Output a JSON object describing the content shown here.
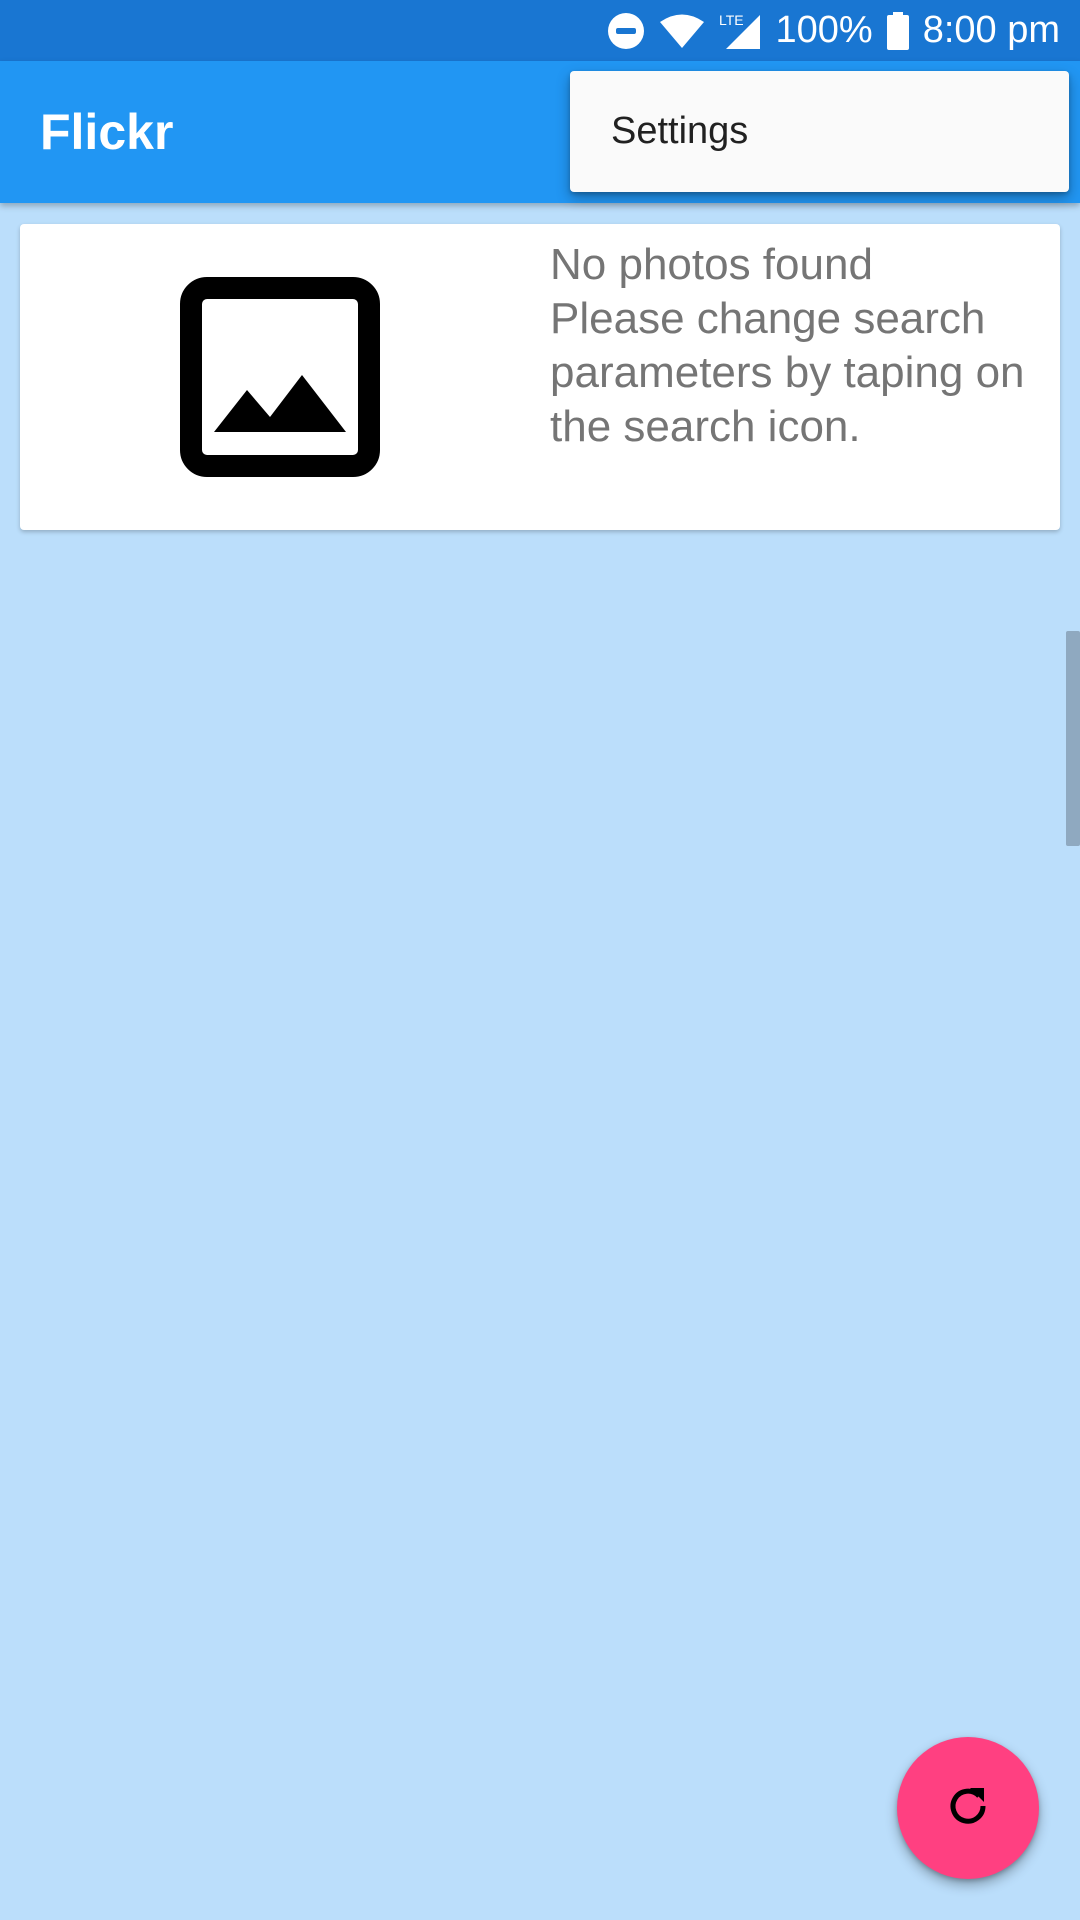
{
  "status_bar": {
    "battery": "100%",
    "time": "8:00 pm",
    "network": "LTE",
    "icons": [
      "do-not-disturb-icon",
      "wifi-icon",
      "cell-signal-icon",
      "battery-icon"
    ]
  },
  "app_bar": {
    "title": "Flickr"
  },
  "overflow_menu": {
    "items": [
      {
        "label": "Settings"
      }
    ]
  },
  "card": {
    "icon": "image-placeholder-icon",
    "message_lines": [
      "No photos found",
      "Please change search",
      "parameters by taping on",
      "the search icon."
    ]
  },
  "fab": {
    "icon": "refresh-icon"
  },
  "colors": {
    "status_bar": "#1976D2",
    "app_bar": "#2196F3",
    "background": "#BBDEFB",
    "fab": "#FF4081",
    "card_text": "#757575"
  }
}
